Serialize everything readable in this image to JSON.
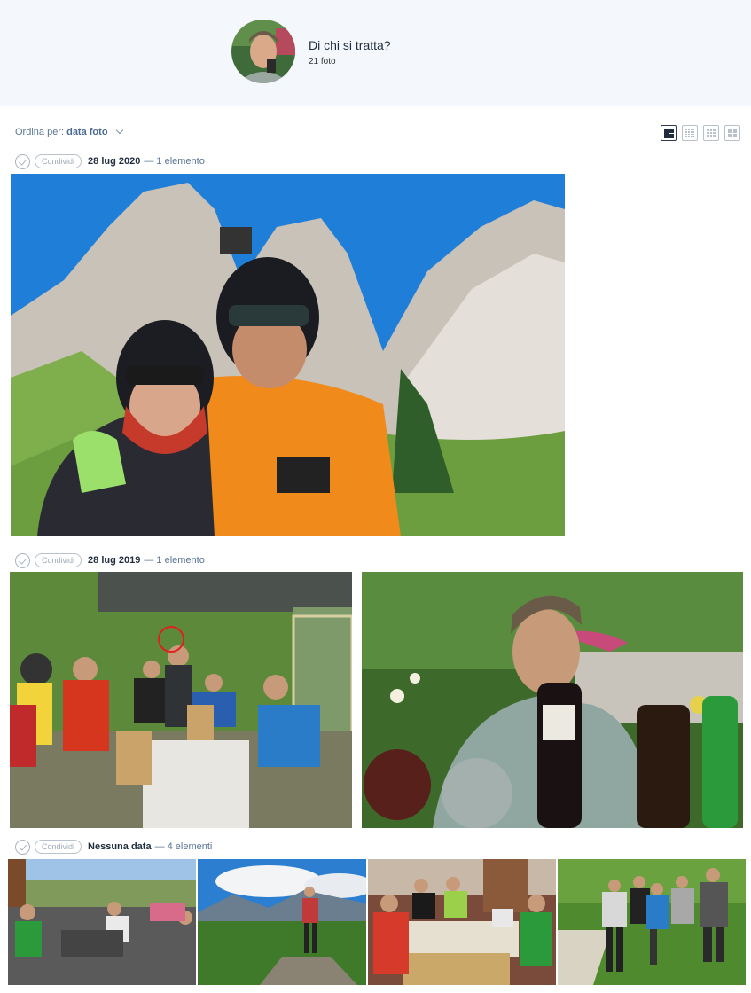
{
  "person": {
    "title": "Di chi si tratta?",
    "count": "21 foto"
  },
  "sort": {
    "label": "Ordina per:",
    "value": "data foto"
  },
  "view_modes": [
    "large",
    "small",
    "medium",
    "square"
  ],
  "groups": [
    {
      "date": "28 lug 2020",
      "count": "— 1 elemento",
      "share": "Condividi"
    },
    {
      "date": "28 lug 2019",
      "count": "— 1 elemento",
      "share": "Condividi"
    },
    {
      "date": "Nessuna data",
      "count": "— 4 elementi",
      "share": "Condividi"
    }
  ],
  "photos": [
    {
      "subject": "mountain-selfie"
    },
    {
      "subject": "group-picnic"
    },
    {
      "subject": "man-with-wine"
    },
    {
      "subject": "terrace-group"
    },
    {
      "subject": "mountain-hiker"
    },
    {
      "subject": "table-dinner"
    },
    {
      "subject": "bikers-group"
    }
  ]
}
